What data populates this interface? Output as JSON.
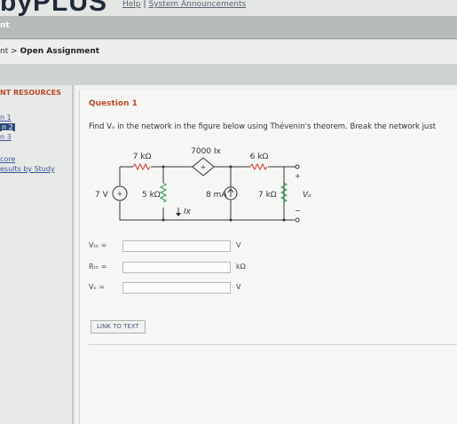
{
  "header": {
    "logo": "byPLUS",
    "links": [
      "Help",
      "System Announcements"
    ],
    "link_sep": "|"
  },
  "nav": {
    "active_tab": "nt"
  },
  "breadcrumb": {
    "parent": "nt",
    "sep": ">",
    "current": "Open Assignment"
  },
  "sidebar": {
    "title": "NT RESOURCES",
    "items": [
      {
        "label": "n 1",
        "selected": false
      },
      {
        "label": "n 2",
        "selected": true
      },
      {
        "label": "n 3",
        "selected": false
      },
      {
        "label": "core",
        "selected": false
      },
      {
        "label": "esults by Study",
        "selected": false
      }
    ]
  },
  "question": {
    "title": "Question 1",
    "text": "Find Vₒ in the network in the figure below using Thévenin's theorem. Break the network just"
  },
  "circuit": {
    "r1": "7 kΩ",
    "dep_source": "7000 Ix",
    "r2": "6 kΩ",
    "vsource": "7 V",
    "r3": "5 kΩ",
    "isource": "8 mA",
    "r4": "7 kΩ",
    "vo": "Vₒ",
    "ix": "Ix",
    "plus": "+",
    "minus": "−"
  },
  "answers": [
    {
      "label": "Vₜₕ =",
      "value": "",
      "unit": "V"
    },
    {
      "label": "Rₜₕ =",
      "value": "",
      "unit": "kΩ"
    },
    {
      "label": "Vₒ =",
      "value": "",
      "unit": "V"
    }
  ],
  "link_button": "LINK TO TEXT"
}
